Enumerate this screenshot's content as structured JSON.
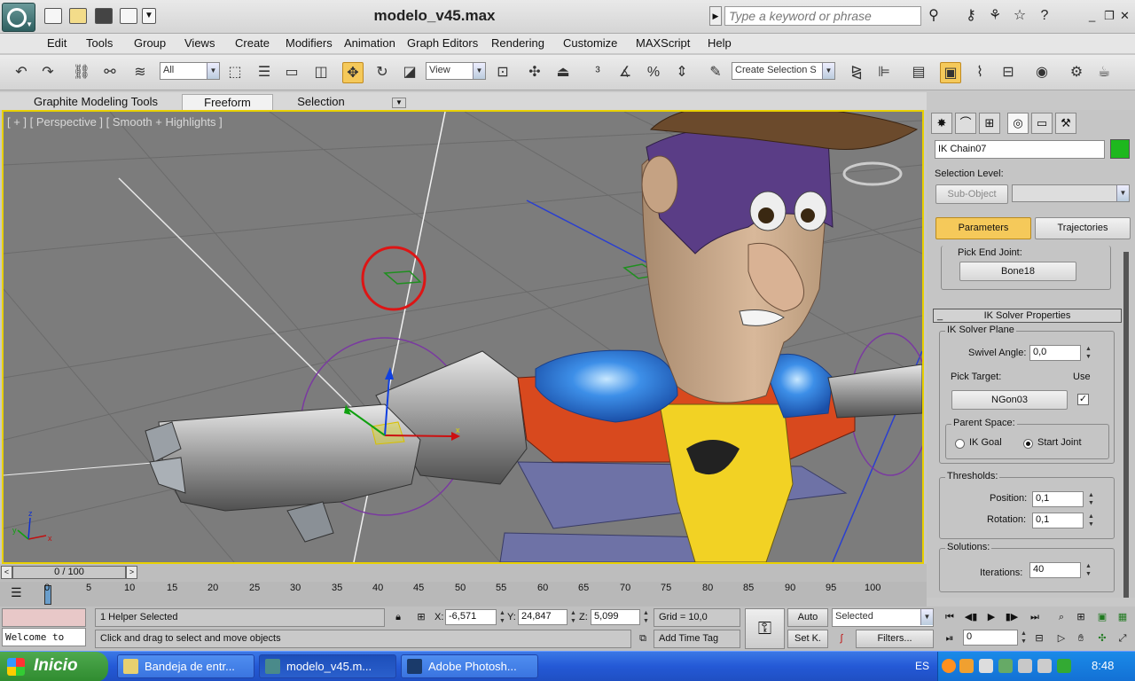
{
  "window": {
    "title": "modelo_v45.max",
    "search_placeholder": "Type a keyword or phrase"
  },
  "menu": [
    "Edit",
    "Tools",
    "Group",
    "Views",
    "Create",
    "Modifiers",
    "Animation",
    "Graph Editors",
    "Rendering",
    "Customize",
    "MAXScript",
    "Help"
  ],
  "toolbar": {
    "filter_value": "All",
    "ref_coord_value": "View",
    "selection_set_value": "Create Selection S"
  },
  "ribbon_tabs": [
    {
      "label": "Graphite Modeling Tools",
      "active": false
    },
    {
      "label": "Freeform",
      "active": true
    },
    {
      "label": "Selection",
      "active": false
    }
  ],
  "viewport": {
    "label": "[ + ] [ Perspective ] [ Smooth + Highlights ]"
  },
  "command_panel": {
    "object_name": "IK Chain07",
    "object_color": "#1eb81e",
    "selection_level_label": "Selection Level:",
    "sub_object_label": "Sub-Object",
    "parameters_tab": "Parameters",
    "trajectories_tab": "Trajectories",
    "pick_end_joint_label": "Pick End Joint:",
    "end_joint_value": "Bone18",
    "ik_solver_properties_title": "IK Solver Properties",
    "ik_solver_plane_title": "IK Solver Plane",
    "swivel_angle_label": "Swivel Angle:",
    "swivel_angle_value": "0,0",
    "pick_target_label": "Pick Target:",
    "use_label": "Use",
    "target_value": "NGon03",
    "use_checked": true,
    "parent_space_title": "Parent Space:",
    "ik_goal_label": "IK Goal",
    "start_joint_label": "Start Joint",
    "parent_space_selected": "Start Joint",
    "thresholds_title": "Thresholds:",
    "position_label": "Position:",
    "position_value": "0,1",
    "rotation_label": "Rotation:",
    "rotation_value": "0,1",
    "solutions_title": "Solutions:",
    "iterations_label": "Iterations:",
    "iterations_value": "40"
  },
  "timeline": {
    "frame_label": "0 / 100",
    "ticks": [
      "0",
      "5",
      "10",
      "15",
      "20",
      "25",
      "30",
      "35",
      "40",
      "45",
      "50",
      "55",
      "60",
      "65",
      "70",
      "75",
      "80",
      "85",
      "90",
      "95",
      "100"
    ]
  },
  "status": {
    "maxscript_listener": "Welcome to",
    "selection_info": "1 Helper Selected",
    "prompt": "Click and drag to select and move objects",
    "x_label": "X:",
    "x_value": "-6,571",
    "y_label": "Y:",
    "y_value": "24,847",
    "z_label": "Z:",
    "z_value": "5,099",
    "grid": "Grid = 10,0",
    "add_time_tag": "Add Time Tag",
    "auto_key": "Auto",
    "set_key": "Set K.",
    "key_filter_value": "Selected",
    "filters": "Filters...",
    "current_frame": "0"
  },
  "taskbar": {
    "start": "Inicio",
    "tasks": [
      "Bandeja de entr...",
      "modelo_v45.m...",
      "Adobe Photosh..."
    ],
    "language": "ES",
    "clock": "8:48"
  }
}
